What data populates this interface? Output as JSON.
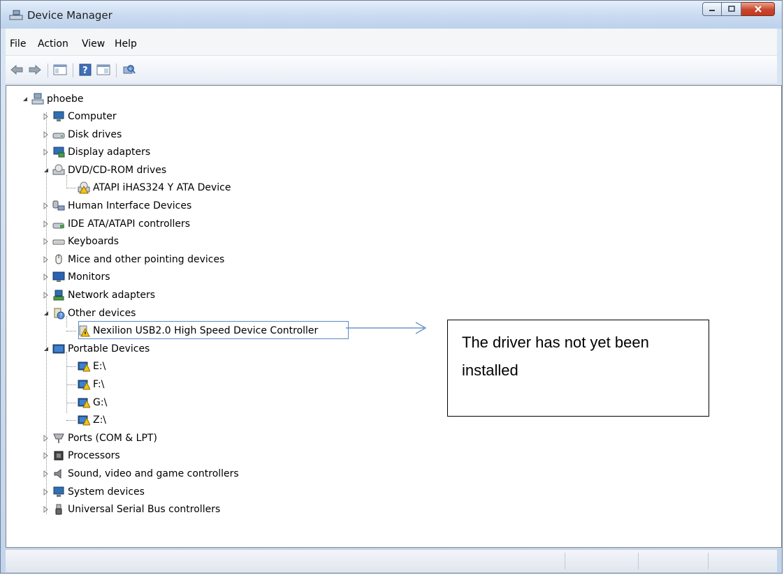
{
  "window": {
    "title": "Device Manager"
  },
  "menu": [
    "File",
    "Action",
    "View",
    "Help"
  ],
  "tree": {
    "root": "phoebe",
    "items": [
      {
        "label": "Computer",
        "icon": "computer-icon"
      },
      {
        "label": "Disk drives",
        "icon": "disk-drive-icon"
      },
      {
        "label": "Display adapters",
        "icon": "display-adapter-icon"
      },
      {
        "label": "DVD/CD-ROM drives",
        "icon": "dvd-drive-icon"
      },
      {
        "label": "ATAPI iHAS324   Y ATA Device",
        "icon": "dvd-device-warning-icon"
      },
      {
        "label": "Human Interface Devices",
        "icon": "hid-icon"
      },
      {
        "label": "IDE ATA/ATAPI controllers",
        "icon": "ide-controller-icon"
      },
      {
        "label": "Keyboards",
        "icon": "keyboard-icon"
      },
      {
        "label": "Mice and other pointing devices",
        "icon": "mouse-icon"
      },
      {
        "label": "Monitors",
        "icon": "monitor-icon"
      },
      {
        "label": "Network adapters",
        "icon": "network-adapter-icon"
      },
      {
        "label": "Other devices",
        "icon": "unknown-device-icon"
      },
      {
        "label": "Nexilion USB2.0 High Speed Device Controller",
        "icon": "device-warning-icon"
      },
      {
        "label": "Portable Devices",
        "icon": "portable-device-icon"
      },
      {
        "label": "E:\\",
        "icon": "portable-drive-warning-icon"
      },
      {
        "label": "F:\\",
        "icon": "portable-drive-warning-icon"
      },
      {
        "label": "G:\\",
        "icon": "portable-drive-warning-icon"
      },
      {
        "label": "Z:\\",
        "icon": "portable-drive-warning-icon"
      },
      {
        "label": "Ports (COM & LPT)",
        "icon": "port-icon"
      },
      {
        "label": "Processors",
        "icon": "processor-icon"
      },
      {
        "label": "Sound, video and game controllers",
        "icon": "speaker-icon"
      },
      {
        "label": "System devices",
        "icon": "system-device-icon"
      },
      {
        "label": "Universal Serial Bus controllers",
        "icon": "usb-icon"
      }
    ]
  },
  "callout": {
    "text": "The driver has not yet been installed"
  },
  "colors": {
    "accent": "#5a89c9",
    "warning": "#f3c318",
    "titlebar": "#cbdcf1"
  }
}
